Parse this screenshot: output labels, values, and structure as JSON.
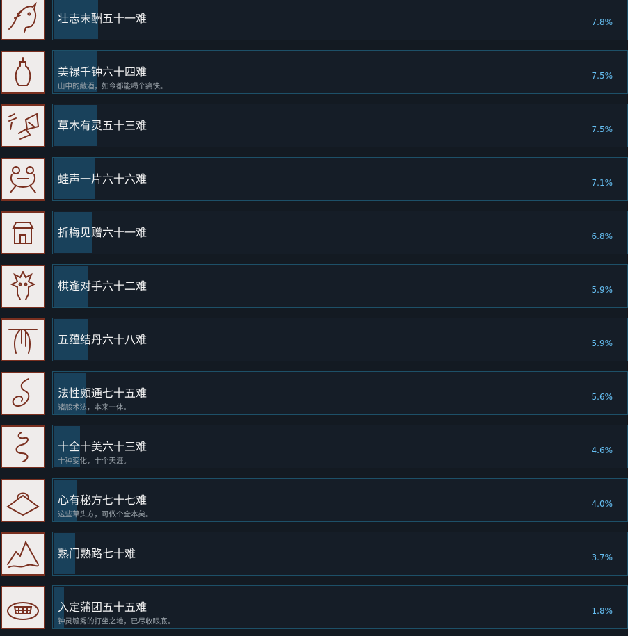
{
  "achievements": [
    {
      "title": "壮志未酬五十一难",
      "desc": "",
      "percent": "7.8%",
      "fill": 7.8,
      "icon": "horse-head-icon"
    },
    {
      "title": "美禄千钟六十四难",
      "desc": "山中的藏酒，如今都能喝个痛快。",
      "percent": "7.5%",
      "fill": 7.5,
      "icon": "wine-vase-icon"
    },
    {
      "title": "草木有灵五十三难",
      "desc": "",
      "percent": "7.5%",
      "fill": 7.5,
      "icon": "plant-sketch-icon"
    },
    {
      "title": "蛙声一片六十六难",
      "desc": "",
      "percent": "7.1%",
      "fill": 7.1,
      "icon": "frog-icon"
    },
    {
      "title": "折梅见赠六十一难",
      "desc": "",
      "percent": "6.8%",
      "fill": 6.8,
      "icon": "house-icon"
    },
    {
      "title": "棋逢对手六十二难",
      "desc": "",
      "percent": "5.9%",
      "fill": 5.9,
      "icon": "demon-mask-icon"
    },
    {
      "title": "五蕴结丹六十八难",
      "desc": "",
      "percent": "5.9%",
      "fill": 5.9,
      "icon": "braid-icon"
    },
    {
      "title": "法性颇通七十五难",
      "desc": "诸般术法，本来一体。",
      "percent": "5.6%",
      "fill": 5.6,
      "icon": "swirl-icon"
    },
    {
      "title": "十全十美六十三难",
      "desc": "十种变化，十个天涯。",
      "percent": "4.6%",
      "fill": 4.6,
      "icon": "smoke-icon"
    },
    {
      "title": "心有秘方七十七难",
      "desc": "这些草头方，可做个全本矣。",
      "percent": "4.0%",
      "fill": 4.0,
      "icon": "recipe-cloth-icon"
    },
    {
      "title": "熟门熟路七十难",
      "desc": "",
      "percent": "3.7%",
      "fill": 3.7,
      "icon": "mountain-icon"
    },
    {
      "title": "入定蒲团五十五难",
      "desc": "钟灵毓秀的打坐之地，已尽收眼底。",
      "percent": "1.8%",
      "fill": 1.8,
      "icon": "meditation-cushion-icon"
    }
  ]
}
